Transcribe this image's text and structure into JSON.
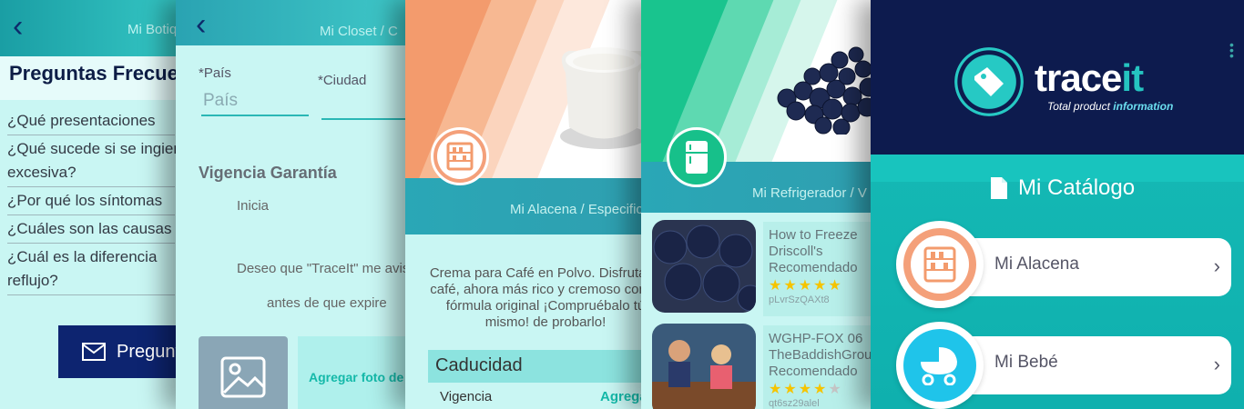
{
  "faq": {
    "breadcrumb": "Mi Botiquín",
    "title": "Preguntas Frecuentes",
    "questions": [
      "¿Qué presentaciones",
      "¿Qué sucede si se ingiere",
      "excesiva?",
      "¿Por qué los síntomas",
      "¿Cuáles son las causas",
      "¿Cuál es la diferencia",
      "reflujo?"
    ],
    "ask_button": "Preguntar"
  },
  "closet": {
    "breadcrumb": "Mi Closet / C",
    "country_label": "*País",
    "country_placeholder": "País",
    "city_label": "*Ciudad",
    "warranty_title": "Vigencia Garantía",
    "starts": "Inicia",
    "reminder_line1": "Deseo que \"TraceIt\" me avise",
    "reminder_line2": "antes de que expire",
    "add_photo": "Agregar foto de"
  },
  "pantry": {
    "breadcrumb": "Mi Alacena / Especificaciones",
    "description": "Crema para Café en Polvo. Disfruta tu café, ahora más rico y cremoso con la fórmula original ¡Compruébalo tú mismo! de probarlo!",
    "expiry_title": "Caducidad",
    "validity": "Vigencia",
    "add": "Agregar"
  },
  "fridge": {
    "breadcrumb": "Mi Refrigerador / V",
    "videos": [
      {
        "title": "How to Freeze",
        "author": "Driscoll's",
        "label": "Recomendado",
        "rating": 5,
        "id": "pLvrSzQAXt8"
      },
      {
        "title": "WGHP-FOX 06",
        "author": "TheBaddishGroup",
        "label": "Recomendado",
        "rating": 4,
        "id": "qt6sz29alel"
      }
    ]
  },
  "catalog": {
    "brand_main": "trace",
    "brand_accent": "it",
    "tagline_main": "Total product ",
    "tagline_accent": "information",
    "title": "Mi Catálogo",
    "items": [
      {
        "label": "Mi Alacena",
        "icon": "pantry-shelf-icon"
      },
      {
        "label": "Mi Bebé",
        "icon": "baby-stroller-icon"
      }
    ]
  },
  "colors": {
    "navy": "#0d1b4e",
    "teal": "#18c4be",
    "orange": "#f39b6d",
    "green": "#19c48e"
  }
}
